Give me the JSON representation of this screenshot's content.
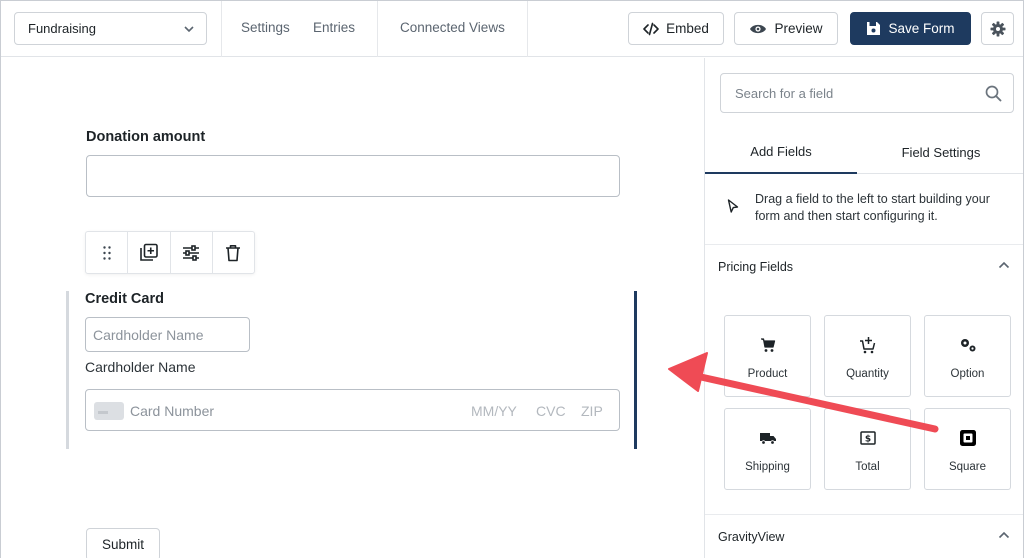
{
  "topbar": {
    "form_name": "Fundraising",
    "nav": [
      "Settings",
      "Entries",
      "Connected Views"
    ],
    "embed_label": "Embed",
    "preview_label": "Preview",
    "save_label": "Save Form"
  },
  "canvas": {
    "donation_label": "Donation amount",
    "credit_card_label": "Credit Card",
    "cardholder_placeholder": "Cardholder Name",
    "cardholder_sublabel": "Cardholder Name",
    "card_number_placeholder": "Card Number",
    "expiry_placeholder": "MM/YY",
    "cvc_placeholder": "CVC",
    "zip_placeholder": "ZIP",
    "submit_label": "Submit"
  },
  "sidebar": {
    "search_placeholder": "Search for a field",
    "tabs": [
      "Add Fields",
      "Field Settings"
    ],
    "hint": "Drag a field to the left to start building your form and then start configuring it.",
    "sections": [
      {
        "title": "Pricing Fields",
        "fields": [
          {
            "label": "Product",
            "icon": "cart-icon"
          },
          {
            "label": "Quantity",
            "icon": "cart-add-icon"
          },
          {
            "label": "Option",
            "icon": "gears-icon"
          },
          {
            "label": "Shipping",
            "icon": "truck-icon"
          },
          {
            "label": "Total",
            "icon": "dollar-icon"
          },
          {
            "label": "Square",
            "icon": "square-logo-icon"
          }
        ]
      },
      {
        "title": "GravityView",
        "fields": []
      }
    ]
  },
  "colors": {
    "primary": "#1e3a5f",
    "arrow": "#ef4b55",
    "border": "#cfd3d8"
  }
}
